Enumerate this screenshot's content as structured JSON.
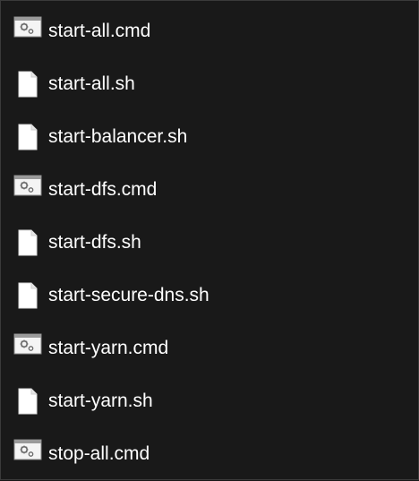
{
  "files": [
    {
      "name": "start-all.cmd",
      "icon": "batch-file-icon"
    },
    {
      "name": "start-all.sh",
      "icon": "document-icon"
    },
    {
      "name": "start-balancer.sh",
      "icon": "document-icon"
    },
    {
      "name": "start-dfs.cmd",
      "icon": "batch-file-icon"
    },
    {
      "name": "start-dfs.sh",
      "icon": "document-icon"
    },
    {
      "name": "start-secure-dns.sh",
      "icon": "document-icon"
    },
    {
      "name": "start-yarn.cmd",
      "icon": "batch-file-icon"
    },
    {
      "name": "start-yarn.sh",
      "icon": "document-icon"
    },
    {
      "name": "stop-all.cmd",
      "icon": "batch-file-icon"
    }
  ],
  "colors": {
    "background": "#191919",
    "text": "#ffffff",
    "icon_fill": "#ffffff",
    "icon_header": "#9a9a9a"
  }
}
